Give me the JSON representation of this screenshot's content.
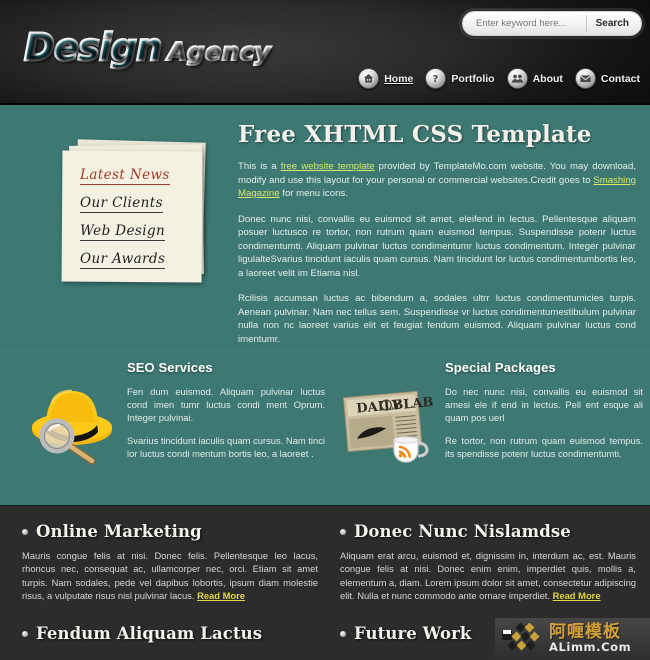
{
  "header": {
    "logo": {
      "word1": "Design",
      "word2": "Agency"
    },
    "search": {
      "placeholder": "Enter keyword here...",
      "value": "",
      "button_label": "Search"
    },
    "nav": [
      {
        "label": "Home",
        "icon": "house-icon",
        "active": true
      },
      {
        "label": "Portfolio",
        "icon": "question-mark-icon",
        "active": false
      },
      {
        "label": "About",
        "icon": "people-icon",
        "active": false
      },
      {
        "label": "Contact",
        "icon": "envelope-icon",
        "active": false
      }
    ]
  },
  "sidebar": {
    "links": [
      {
        "label": "Latest News",
        "highlight": true
      },
      {
        "label": "Our Clients",
        "highlight": false
      },
      {
        "label": "Web Design",
        "highlight": false
      },
      {
        "label": "Our Awards",
        "highlight": false
      }
    ]
  },
  "main": {
    "title": "Free XHTML CSS Template",
    "intro": {
      "part1": "This is a ",
      "link1": "free website template",
      "part2": " provided by TemplateMo.com website. You may download, modify and use this layout for your personal or commercial websites.Credit goes to ",
      "link2": "Smashing Magazine",
      "part3": " for menu icons."
    },
    "paragraph2": "Donec nunc nisi, convallis eu euismod sit amet, eleifend in lectus. Pellentesque aliquam posuer luctusco re tortor, non rutrum quam euismod tempus. Suspendisse potenr luctus condimentumti. Aliquam pulvinar luctus condimentumr luctus condimentum. Integer pulvinar ligulalteSvarius tincidunt iaculis quam cursus. Nam tincidunt lor luctus condimentumbortis leo, a laoreet velit im Etiama nisl.",
    "paragraph3": "Rcilisis accumsan luctus ac bibendum a, sodales ultrr luctus condimentumicies turpis. Aenean pulvinar. Nam nec tellus sem. Suspendisse vr luctus condimentumestibulum pulvinar nulla non nc laoreet varius elit et feugiat fendum euismod. Aliquam pulvinar luctus cond imentumr."
  },
  "services": [
    {
      "icon": "hat-magnifier-icon",
      "title": "SEO Services",
      "p1": "Fen dum euismod. Aliquam pulvinar luctus cond imen tumr luctus condi ment Oprum. Integer pulvinai.",
      "p2": "Svarius tincidunt iaculis quam cursus. Nam tinci lor luctus condi mentum bortis leo, a laoreet ."
    },
    {
      "icon": "newspaper-coffee-icon",
      "title": "Special Packages",
      "p1": "Do nec nunc nisi, convallis eu euismod sit amesi ele if end in lectus. Pell ent esque ali quam pos uerl",
      "p2": "Re tortor, non rutrum quam euismod tempus. its spendisse potenr luctus condimentumti."
    }
  ],
  "bottom": {
    "blocks": [
      {
        "title": "Online Marketing",
        "text": "Mauris congue felis at nisi. Donec felis. Pellentesque leo lacus, rhoncus nec, consequat ac, ullamcorper nec, orci. Etiam sit amet turpis. Nam sodales, pede vel dapibus lobortis, ipsum diam molestie risus, a vulputate risus nisl pulvinar lacus. ",
        "link": "Read More"
      },
      {
        "title": "Donec Nunc Nislamdse",
        "text": "Aliquam erat arcu, euismod et, dignissim in, interdum ac, est. Mauris congue felis at nisi. Donec enim enim, imperdiet quis, mollis a, elementum a, diam. Lorem ipsum dolor sit amet, consectetur adipiscing elit. Nulla et nunc commodo ante ornare imperdiet. ",
        "link": "Read More"
      },
      {
        "title": "Fendum Aliquam Lactus",
        "text": "",
        "link": ""
      },
      {
        "title": "Future Work",
        "text": "",
        "link": ""
      }
    ]
  },
  "watermark": {
    "cn": "阿喱模板",
    "en": "ALimm.Com"
  },
  "colors": {
    "teal": "#3d7873",
    "dark": "#2c2c2c",
    "header": "#0b0b0b",
    "accent_yellow": "#e0d44a",
    "accent_green_link": "#d8e86a",
    "note_paper": "#f4f1e3",
    "note_highlight": "#9e3b2a",
    "watermark_gold": "#d9a33a"
  }
}
